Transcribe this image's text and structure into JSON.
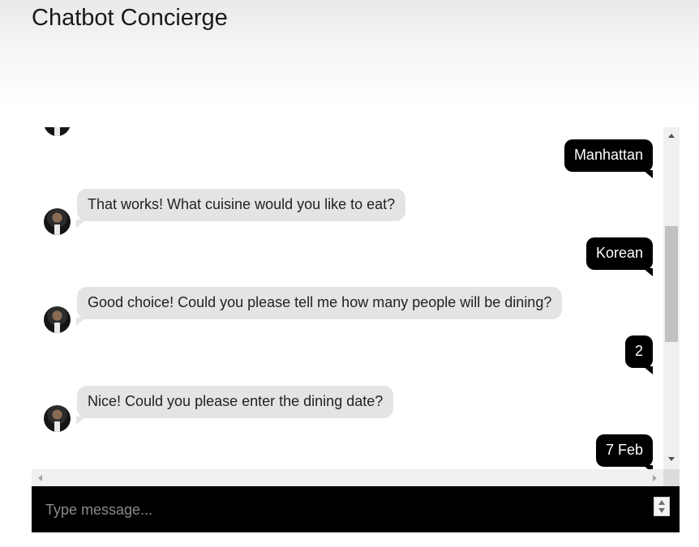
{
  "app": {
    "title": "Chatbot Concierge"
  },
  "messages": [
    {
      "sender": "user",
      "text": "Manhattan"
    },
    {
      "sender": "bot",
      "text": "That works! What cuisine would you like to eat?"
    },
    {
      "sender": "user",
      "text": "Korean"
    },
    {
      "sender": "bot",
      "text": "Good choice! Could you please tell me how many people will be dining?"
    },
    {
      "sender": "user",
      "text": "2"
    },
    {
      "sender": "bot",
      "text": "Nice! Could you please enter the dining date?"
    },
    {
      "sender": "user",
      "text": "7 Feb"
    }
  ],
  "input": {
    "placeholder": "Type message..."
  },
  "colors": {
    "user_bubble": "#000000",
    "bot_bubble": "#e4e4e4",
    "input_bar": "#000000"
  },
  "icons": {
    "bot_avatar": "bot-avatar-photo"
  }
}
